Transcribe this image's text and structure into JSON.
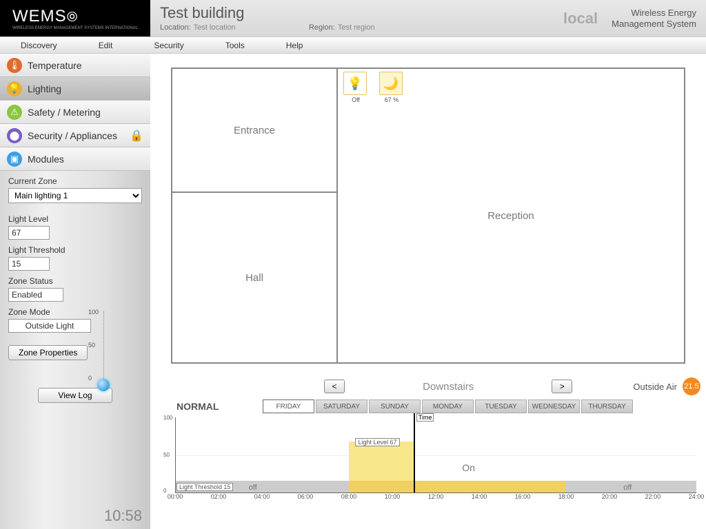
{
  "header": {
    "logo": "WEMS",
    "logo_sub": "WIRELESS ENERGY MANAGEMENT SYSTEMS INTERNATIONAL",
    "title": "Test building",
    "location_lbl": "Location:",
    "location": "Test location",
    "region_lbl": "Region:",
    "region": "Test region",
    "local": "local",
    "brand1": "Wireless Energy",
    "brand2": "Management System"
  },
  "menu": [
    "Discovery",
    "Edit",
    "Security",
    "Tools",
    "Help"
  ],
  "sidebar": {
    "cats": [
      {
        "label": "Temperature",
        "color": "#e06a2a"
      },
      {
        "label": "Lighting",
        "color": "#e8b030"
      },
      {
        "label": "Safety / Metering",
        "color": "#8cc63f"
      },
      {
        "label": "Security / Appliances",
        "color": "#7a5cc4",
        "lock": true
      },
      {
        "label": "Modules",
        "color": "#3aa0e8"
      }
    ],
    "zone_lbl": "Current Zone",
    "zone_value": "Main lighting 1",
    "light_level_lbl": "Light Level",
    "light_level": "67",
    "light_thresh_lbl": "Light Threshold",
    "light_thresh": "15",
    "zone_status_lbl": "Zone Status",
    "zone_status": "Enabled",
    "zone_mode_lbl": "Zone Mode",
    "zone_mode": "Outside Light",
    "btn_props": "Zone Properties",
    "btn_log": "View Log",
    "gauge": {
      "max": "100",
      "mid": "50",
      "min": "0"
    }
  },
  "clock": "10:58",
  "rooms": {
    "entrance": "Entrance",
    "hall": "Hall",
    "reception": "Reception"
  },
  "widgets": {
    "status": "Off",
    "dim": "67 %"
  },
  "schedule": {
    "floor": "Downstairs",
    "outside_air_lbl": "Outside Air",
    "outside_air": "21.5",
    "mode": "NORMAL",
    "days": [
      "FRIDAY",
      "SATURDAY",
      "SUNDAY",
      "MONDAY",
      "TUESDAY",
      "WEDNESDAY",
      "THURSDAY"
    ],
    "selected_day": 0,
    "ll_box": "Light Level   67",
    "lt_box": "Light Threshold   15",
    "on": "On",
    "off": "off",
    "time_lbl": "Time"
  },
  "chart_data": {
    "type": "area",
    "title": "",
    "xlabel": "",
    "ylabel": "",
    "x_ticks": [
      "00:00",
      "02:00",
      "04:00",
      "06:00",
      "08:00",
      "10:00",
      "12:00",
      "14:00",
      "16:00",
      "18:00",
      "20:00",
      "22:00",
      "24:00"
    ],
    "ylim": [
      0,
      100
    ],
    "light_threshold": 15,
    "current_time_hours": 10.97,
    "on_periods": [
      {
        "start": 8,
        "end": 18
      }
    ],
    "light_level_period": {
      "start": 8,
      "end": 11,
      "value": 67
    }
  }
}
